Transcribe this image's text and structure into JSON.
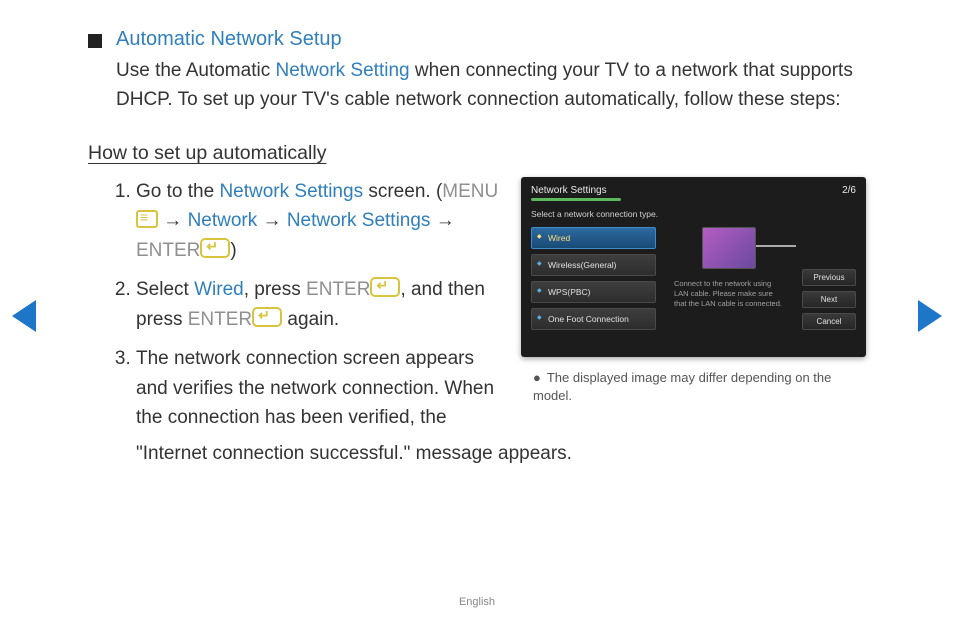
{
  "title": "Automatic Network Setup",
  "lead": {
    "p1a": "Use the Automatic ",
    "net_setting": "Network Setting",
    "p1b": " when connecting your TV to a network that supports DHCP. To set up your TV's cable network connection automatically, follow these steps:"
  },
  "subheading": "How to set up automatically",
  "steps": {
    "s1": {
      "a": "Go to the ",
      "link1": "Network Settings",
      "b": " screen. (",
      "menu": "MENU",
      "arrow1": " → ",
      "link2": "Network",
      "arrow2": " → ",
      "link3": "Network Settings",
      "arrow3": " → ",
      "enter": "ENTER",
      "c": ")"
    },
    "s2": {
      "a": "Select ",
      "wired": "Wired",
      "b": ", press ",
      "enter1": "ENTER",
      "c": ", and then press ",
      "enter2": "ENTER",
      "d": " again."
    },
    "s3": {
      "a": "The network connection screen appears and verifies the network connection. When the connection has been verified, the",
      "b": "\"Internet connection successful.\" message appears."
    }
  },
  "tvshot": {
    "title": "Network Settings",
    "page": "2/6",
    "prompt": "Select a network connection type.",
    "items": [
      "Wired",
      "Wireless(General)",
      "WPS(PBC)",
      "One Foot Connection"
    ],
    "helper": "Connect to the network using LAN cable. Please make sure that the LAN cable is connected.",
    "btn_prev": "Previous",
    "btn_next": "Next",
    "btn_cancel": "Cancel"
  },
  "disclaimer": "The displayed image may differ depending on the model.",
  "footer": "English"
}
